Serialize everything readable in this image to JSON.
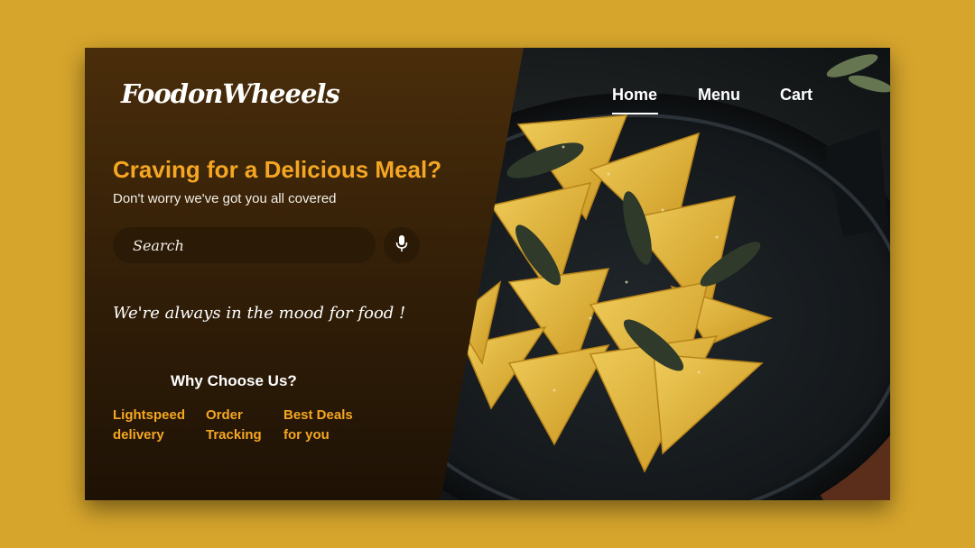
{
  "brand": {
    "logo_text": "FoodonWheeels"
  },
  "nav": {
    "items": [
      "Home",
      "Menu",
      "Cart"
    ],
    "active": "Home"
  },
  "hero": {
    "headline": "Craving for a Delicious Meal?",
    "subheadline": "Don't worry we've got you all covered",
    "tagline": "We're always in the mood for food !"
  },
  "search": {
    "placeholder": "Search"
  },
  "why": {
    "title": "Why Choose Us?",
    "features": [
      "Lightspeed delivery",
      "Order Tracking",
      "Best Deals for you"
    ]
  },
  "colors": {
    "accent": "#f5a623",
    "background": "#d6a52c",
    "panel": "#3a230a"
  },
  "icons": {
    "voice_search": "microphone-icon"
  }
}
